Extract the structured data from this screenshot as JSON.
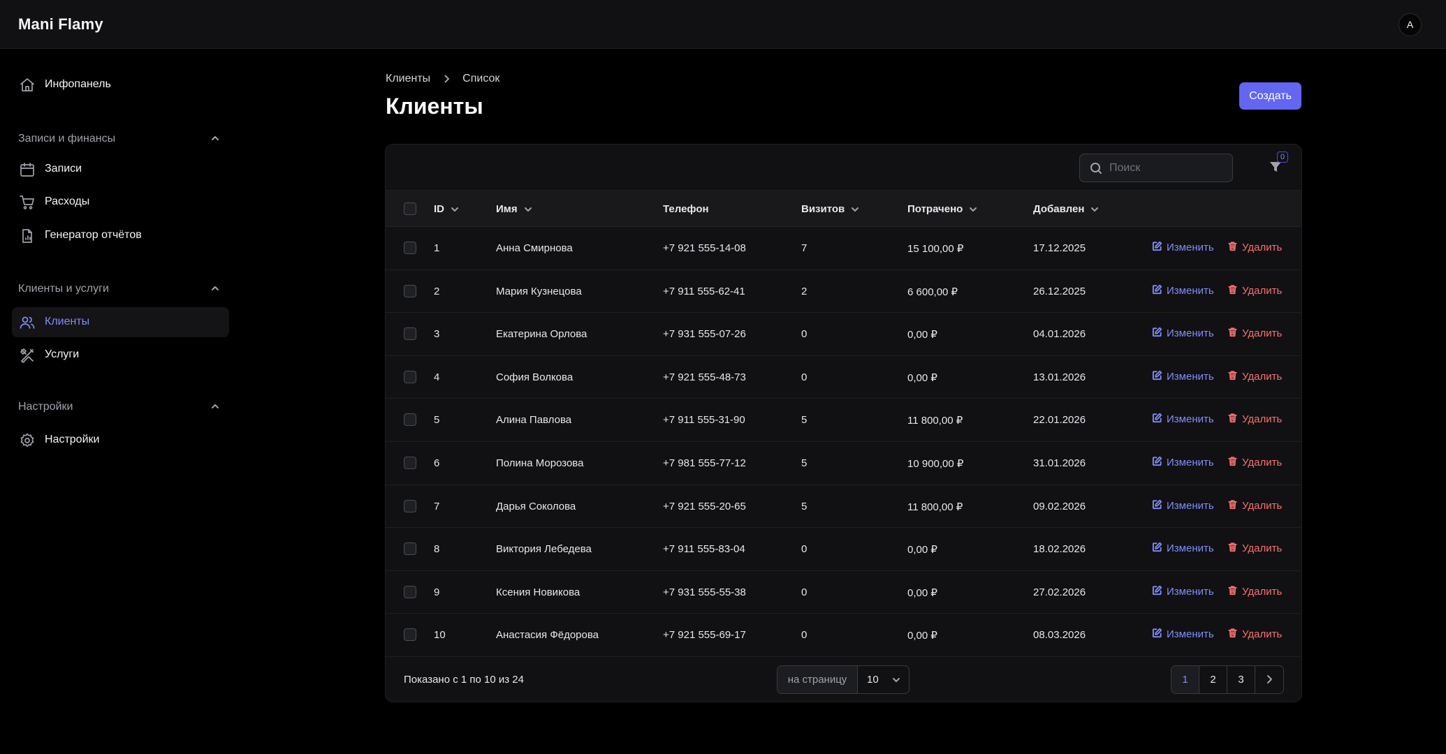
{
  "app": {
    "brand": "Mani Flamy",
    "avatar_letter": "A"
  },
  "sidebar": {
    "dashboard": {
      "label": "Инфопанель",
      "icon": "home-icon"
    },
    "groups": [
      {
        "title": "Записи и финансы",
        "items": [
          {
            "label": "Записи",
            "icon": "calendar-icon"
          },
          {
            "label": "Расходы",
            "icon": "cart-icon"
          },
          {
            "label": "Генератор отчётов",
            "icon": "report-file-icon"
          }
        ]
      },
      {
        "title": "Клиенты и услуги",
        "items": [
          {
            "label": "Клиенты",
            "icon": "users-icon",
            "active": true
          },
          {
            "label": "Услуги",
            "icon": "tools-icon"
          }
        ]
      },
      {
        "title": "Настройки",
        "items": [
          {
            "label": "Настройки",
            "icon": "gear-icon"
          }
        ]
      }
    ]
  },
  "header": {
    "breadcrumb": [
      "Клиенты",
      "Список"
    ],
    "title": "Клиенты",
    "create_label": "Создать"
  },
  "toolbar": {
    "search_placeholder": "Поиск",
    "filter_count": "0"
  },
  "table": {
    "columns": {
      "id": "ID",
      "name": "Имя",
      "phone": "Телефон",
      "visits": "Визитов",
      "spent": "Потрачено",
      "added": "Добавлен"
    },
    "edit_label": "Изменить",
    "delete_label": "Удалить",
    "rows": [
      {
        "id": "1",
        "name": "Анна Смирнова",
        "phone": "+7 921 555-14-08",
        "visits": "7",
        "spent": "15 100,00 ₽",
        "added": "17.12.2025"
      },
      {
        "id": "2",
        "name": "Мария Кузнецова",
        "phone": "+7 911 555-62-41",
        "visits": "2",
        "spent": "6 600,00 ₽",
        "added": "26.12.2025"
      },
      {
        "id": "3",
        "name": "Екатерина Орлова",
        "phone": "+7 931 555-07-26",
        "visits": "0",
        "spent": "0,00 ₽",
        "added": "04.01.2026"
      },
      {
        "id": "4",
        "name": "София Волкова",
        "phone": "+7 921 555-48-73",
        "visits": "0",
        "spent": "0,00 ₽",
        "added": "13.01.2026"
      },
      {
        "id": "5",
        "name": "Алина Павлова",
        "phone": "+7 911 555-31-90",
        "visits": "5",
        "spent": "11 800,00 ₽",
        "added": "22.01.2026"
      },
      {
        "id": "6",
        "name": "Полина Морозова",
        "phone": "+7 981 555-77-12",
        "visits": "5",
        "spent": "10 900,00 ₽",
        "added": "31.01.2026"
      },
      {
        "id": "7",
        "name": "Дарья Соколова",
        "phone": "+7 921 555-20-65",
        "visits": "5",
        "spent": "11 800,00 ₽",
        "added": "09.02.2026"
      },
      {
        "id": "8",
        "name": "Виктория Лебедева",
        "phone": "+7 911 555-83-04",
        "visits": "0",
        "spent": "0,00 ₽",
        "added": "18.02.2026"
      },
      {
        "id": "9",
        "name": "Ксения Новикова",
        "phone": "+7 931 555-55-38",
        "visits": "0",
        "spent": "0,00 ₽",
        "added": "27.02.2026"
      },
      {
        "id": "10",
        "name": "Анастасия Фёдорова",
        "phone": "+7 921 555-69-17",
        "visits": "0",
        "spent": "0,00 ₽",
        "added": "08.03.2026"
      }
    ]
  },
  "footer": {
    "shown_text": "Показано с 1 по 10 из 24",
    "per_page_label": "на страницу",
    "per_page_value": "10",
    "pages": [
      "1",
      "2",
      "3"
    ],
    "current_page": "1"
  },
  "colors": {
    "accent": "#6366f1",
    "accent_text": "#818cf8",
    "danger": "#f87171",
    "background": "#000000",
    "surface": "#111113"
  }
}
